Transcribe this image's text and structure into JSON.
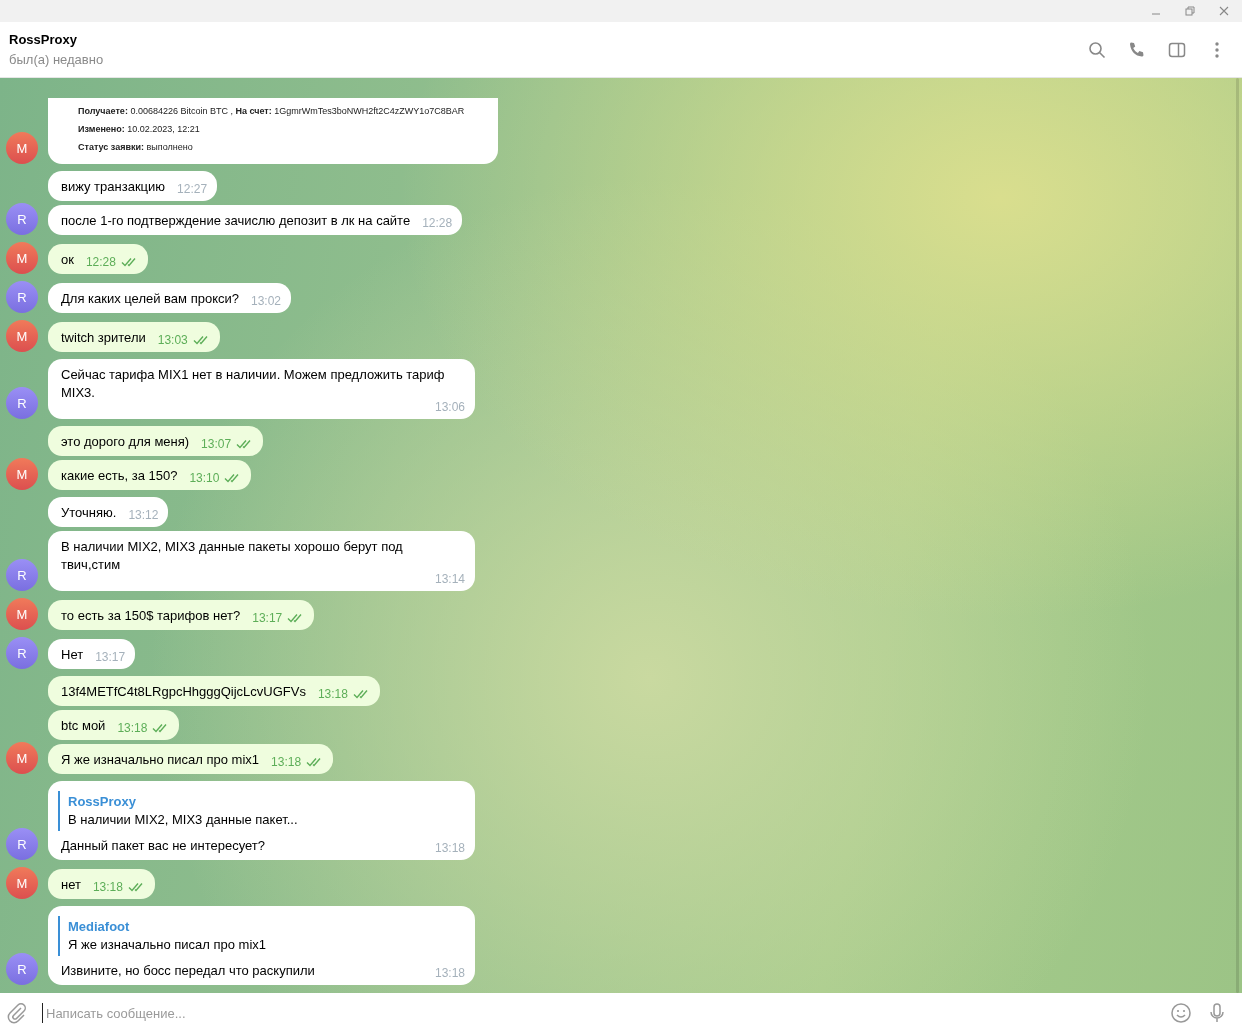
{
  "window": {
    "controls": [
      {
        "kind": "minimize"
      },
      {
        "kind": "restore"
      },
      {
        "kind": "close"
      }
    ]
  },
  "header": {
    "title": "RossProxy",
    "status": "был(а) недавно"
  },
  "groups": [
    {
      "avatar": "M",
      "kind": "out",
      "messages": [
        {
          "kind": "card",
          "lines": [
            "**Получаете:** 0.00684226 Bitcoin BTC , **На счет:** 1GgmrWmTes3boNWH2ft2C4zZWY1o7C8BAR",
            "**Изменено:** 10.02.2023, 12:21",
            "**Статус заявки:** выполнено"
          ]
        }
      ]
    },
    {
      "avatar": "R",
      "kind": "in",
      "messages": [
        {
          "kind": "in",
          "text": "вижу транзакцию",
          "time": "12:27"
        },
        {
          "kind": "in",
          "text": "после 1-го подтверждение зачислю депозит в лк на сайте",
          "time": "12:28"
        }
      ]
    },
    {
      "avatar": "M",
      "kind": "out",
      "messages": [
        {
          "kind": "out",
          "text": "ок",
          "time": "12:28",
          "read": true
        }
      ]
    },
    {
      "avatar": "R",
      "kind": "in",
      "messages": [
        {
          "kind": "in",
          "text": "Для каких целей вам прокси?",
          "time": "13:02"
        }
      ]
    },
    {
      "avatar": "M",
      "kind": "out",
      "messages": [
        {
          "kind": "out",
          "text": "twitch зрители",
          "time": "13:03",
          "read": true
        }
      ]
    },
    {
      "avatar": "R",
      "kind": "in",
      "messages": [
        {
          "kind": "in",
          "text": "Сейчас тарифа MIX1 нет в наличии. Можем предложить тариф MIX3.",
          "time": "13:06"
        }
      ]
    },
    {
      "avatar": "M",
      "kind": "out",
      "messages": [
        {
          "kind": "out",
          "text": "это дорого для меня)",
          "time": "13:07",
          "read": true
        },
        {
          "kind": "out",
          "text": "какие есть, за 150?",
          "time": "13:10",
          "read": true
        }
      ]
    },
    {
      "avatar": "R",
      "kind": "in",
      "messages": [
        {
          "kind": "in",
          "text": "Уточняю.",
          "time": "13:12"
        },
        {
          "kind": "in",
          "text": "В наличии MIX2, MIX3 данные пакеты хорошо берут под твич,стим",
          "time": "13:14"
        }
      ]
    },
    {
      "avatar": "M",
      "kind": "out",
      "messages": [
        {
          "kind": "out",
          "text": "то есть за 150$ тарифов нет?",
          "time": "13:17",
          "read": true
        }
      ]
    },
    {
      "avatar": "R",
      "kind": "in",
      "messages": [
        {
          "kind": "in",
          "text": "Нет",
          "time": "13:17"
        }
      ]
    },
    {
      "avatar": "M",
      "kind": "out",
      "messages": [
        {
          "kind": "out",
          "text": "13f4METfC4t8LRgpcHhgggQijcLcvUGFVs",
          "time": "13:18",
          "read": true
        },
        {
          "kind": "out",
          "text": "btc мой",
          "time": "13:18",
          "read": true
        },
        {
          "kind": "out",
          "text": "Я же изначально писал про mix1",
          "time": "13:18",
          "read": true
        }
      ]
    },
    {
      "avatar": "R",
      "kind": "in",
      "messages": [
        {
          "kind": "in",
          "reply": {
            "author": "RossProxy",
            "text": "В наличии MIX2, MIX3 данные пакет..."
          },
          "text": "Данный пакет вас не интересует?",
          "time": "13:18"
        }
      ]
    },
    {
      "avatar": "M",
      "kind": "out",
      "messages": [
        {
          "kind": "out",
          "text": "нет",
          "time": "13:18",
          "read": true
        }
      ]
    },
    {
      "avatar": "R",
      "kind": "in",
      "messages": [
        {
          "kind": "in",
          "reply": {
            "author": "Mediafoot",
            "text": "Я же изначально писал про mix1"
          },
          "text": "Извините, но босс передал что раскупили",
          "time": "13:18"
        }
      ]
    }
  ],
  "composer": {
    "placeholder": "Написать сообщение..."
  }
}
